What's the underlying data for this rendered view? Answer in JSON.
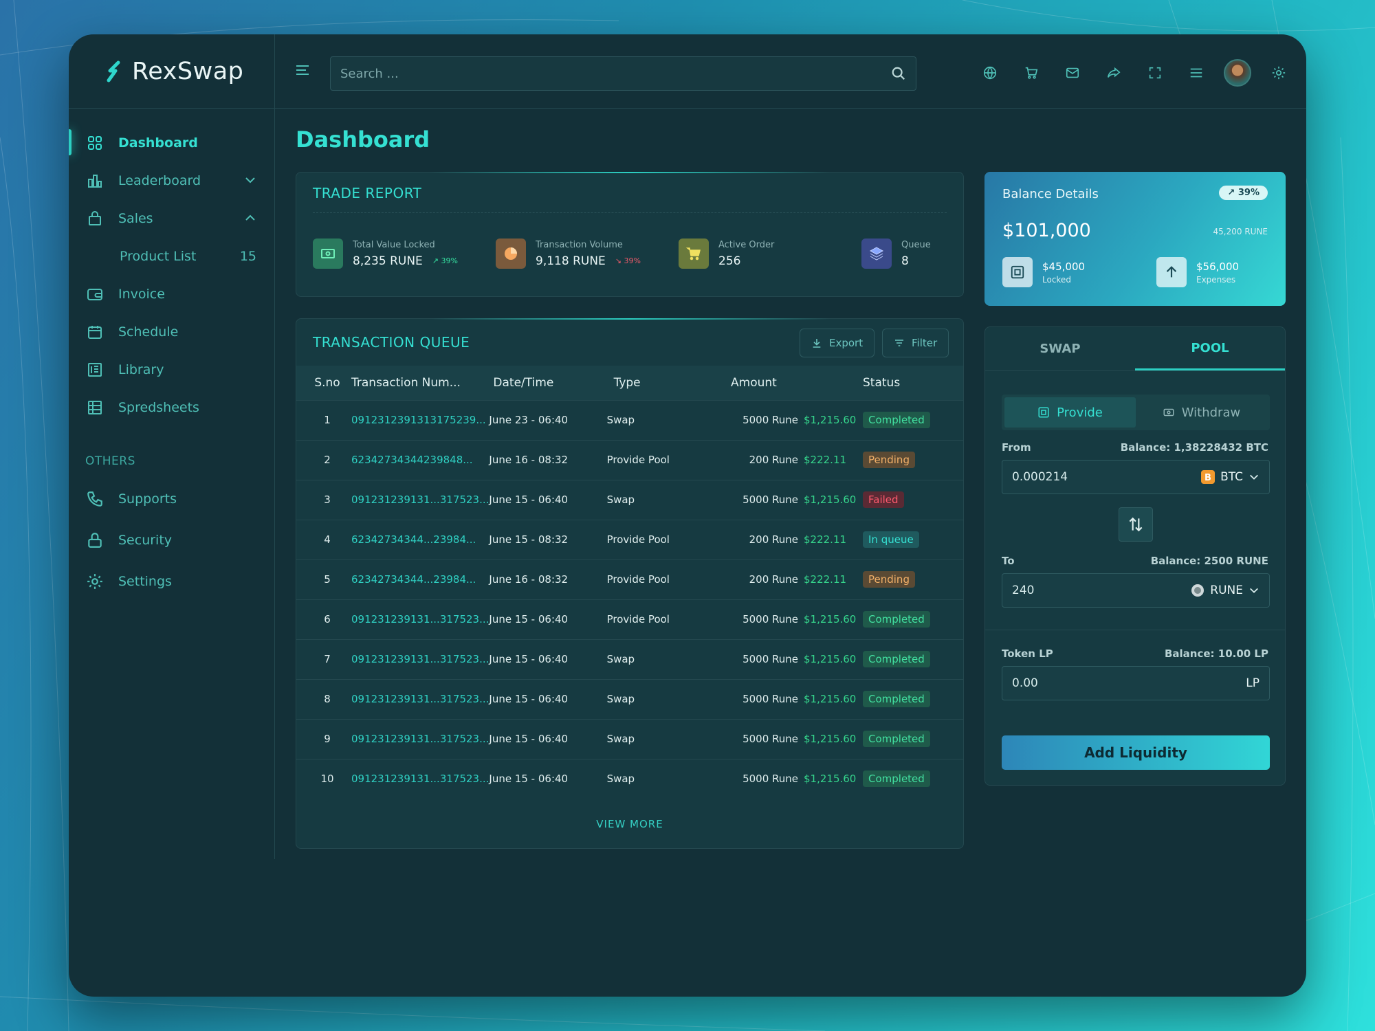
{
  "brand": {
    "name": "RexSwap"
  },
  "search": {
    "placeholder": "Search ..."
  },
  "sidebar": {
    "items": [
      {
        "label": "Dashboard",
        "icon": "grid-icon",
        "active": true
      },
      {
        "label": "Leaderboard",
        "icon": "bar-chart-icon"
      },
      {
        "label": "Sales",
        "icon": "shopping-bag-icon"
      },
      {
        "label": "Invoice",
        "icon": "wallet-icon"
      },
      {
        "label": "Schedule",
        "icon": "calendar-icon"
      },
      {
        "label": "Library",
        "icon": "book-icon"
      },
      {
        "label": "Spredsheets",
        "icon": "table-icon"
      }
    ],
    "sub_item": {
      "label": "Product List",
      "count": "15"
    },
    "others_label": "OTHERS",
    "others": [
      {
        "label": "Supports",
        "icon": "phone-icon"
      },
      {
        "label": "Security",
        "icon": "lock-icon"
      },
      {
        "label": "Settings",
        "icon": "gear-icon"
      }
    ]
  },
  "page": {
    "title": "Dashboard"
  },
  "trade_report": {
    "title": "TRADE REPORT",
    "stats": [
      {
        "label": "Total Value Locked",
        "value": "8,235 RUNE",
        "change": "39%",
        "trend": "up",
        "color": "#2a7a5e"
      },
      {
        "label": "Transaction Volume",
        "value": "9,118 RUNE",
        "change": "39%",
        "trend": "down",
        "color": "#7a5a3c"
      },
      {
        "label": "Active Order",
        "value": "256",
        "color": "#6a7a3c"
      },
      {
        "label": "Queue",
        "value": "8",
        "color": "#3a4a8a"
      }
    ]
  },
  "queue": {
    "title": "TRANSACTION QUEUE",
    "export_label": "Export",
    "filter_label": "Filter",
    "columns": [
      "S.no",
      "Transaction Num...",
      "Date/Time",
      "Type",
      "Amount",
      "Status"
    ],
    "rows": [
      {
        "sno": "1",
        "tx": "0912312391313175239...",
        "date": "June 23 - 06:40",
        "type": "Swap",
        "amount": "5000 Rune",
        "usd": "$1,215.60",
        "status": "Completed",
        "kind": "completed"
      },
      {
        "sno": "2",
        "tx": "62342734344239848...",
        "date": "June 16 - 08:32",
        "type": "Provide Pool",
        "amount": "200 Rune",
        "usd": "$222.11",
        "status": "Pending",
        "kind": "pending"
      },
      {
        "sno": "3",
        "tx": "091231239131...317523...",
        "date": "June 15 - 06:40",
        "type": "Swap",
        "amount": "5000 Rune",
        "usd": "$1,215.60",
        "status": "Failed",
        "kind": "failed"
      },
      {
        "sno": "4",
        "tx": "62342734344...23984...",
        "date": "June 15 - 08:32",
        "type": "Provide Pool",
        "amount": "200 Rune",
        "usd": "$222.11",
        "status": "In queue",
        "kind": "queue"
      },
      {
        "sno": "5",
        "tx": "62342734344...23984...",
        "date": "June 16 - 08:32",
        "type": "Provide Pool",
        "amount": "200 Rune",
        "usd": "$222.11",
        "status": "Pending",
        "kind": "pending"
      },
      {
        "sno": "6",
        "tx": "091231239131...317523...",
        "date": "June 15 - 06:40",
        "type": "Provide Pool",
        "amount": "5000 Rune",
        "usd": "$1,215.60",
        "status": "Completed",
        "kind": "completed"
      },
      {
        "sno": "7",
        "tx": "091231239131...317523...",
        "date": "June 15 - 06:40",
        "type": "Swap",
        "amount": "5000 Rune",
        "usd": "$1,215.60",
        "status": "Completed",
        "kind": "completed"
      },
      {
        "sno": "8",
        "tx": "091231239131...317523...",
        "date": "June 15 - 06:40",
        "type": "Swap",
        "amount": "5000 Rune",
        "usd": "$1,215.60",
        "status": "Completed",
        "kind": "completed"
      },
      {
        "sno": "9",
        "tx": "091231239131...317523...",
        "date": "June 15 - 06:40",
        "type": "Swap",
        "amount": "5000 Rune",
        "usd": "$1,215.60",
        "status": "Completed",
        "kind": "completed"
      },
      {
        "sno": "10",
        "tx": "091231239131...317523...",
        "date": "June 15 - 06:40",
        "type": "Swap",
        "amount": "5000 Rune",
        "usd": "$1,215.60",
        "status": "Completed",
        "kind": "completed"
      }
    ],
    "view_more": "VIEW MORE"
  },
  "balance": {
    "title": "Balance Details",
    "badge": "39%",
    "amount": "$101,000",
    "rune": "45,200 RUNE",
    "locked_value": "$45,000",
    "locked_label": "Locked",
    "expenses_value": "$56,000",
    "expenses_label": "Expenses"
  },
  "pool": {
    "tabs": [
      "SWAP",
      "POOL"
    ],
    "active_tab": "POOL",
    "provide_label": "Provide",
    "withdraw_label": "Withdraw",
    "from_label": "From",
    "from_balance": "Balance: 1,38228432 BTC",
    "from_value": "0.000214",
    "from_token": "BTC",
    "to_label": "To",
    "to_balance": "Balance: 2500 RUNE",
    "to_value": "240",
    "to_token": "RUNE",
    "lp_label": "Token LP",
    "lp_balance": "Balance: 10.00 LP",
    "lp_value": "0.00",
    "lp_unit": "LP",
    "add_label": "Add Liquidity"
  },
  "colors": {
    "accent": "#2ccfc2",
    "bg": "#133038",
    "success": "#42e0a0",
    "danger": "#ff5a6e",
    "warning": "#f2b068"
  }
}
